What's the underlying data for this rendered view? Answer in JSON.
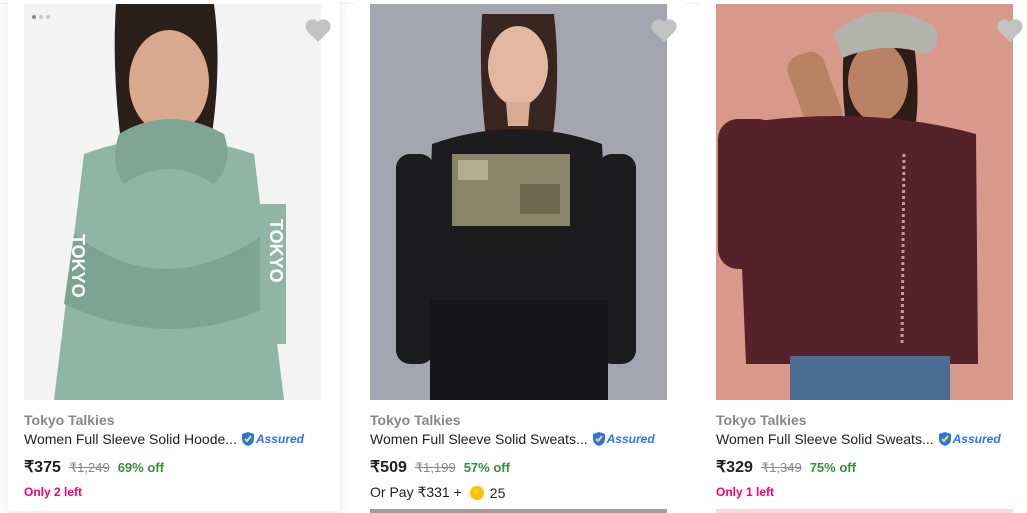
{
  "colors": {
    "accent": "#2874f0",
    "discount_green": "#388e3c",
    "stock_pink": "#ff0066",
    "brand_grey": "#878787"
  },
  "products": [
    {
      "brand": "Tokyo Talkies",
      "title": "Women Full Sleeve Solid Hoode...",
      "assured": "Assured",
      "price": "₹375",
      "mrp": "₹1,249",
      "discount": "69% off",
      "stock": "Only 2 left",
      "image_icon": "hoodie-model-image",
      "carousel_dots": 3
    },
    {
      "brand": "Tokyo Talkies",
      "title": "Women Full Sleeve Solid Sweats...",
      "assured": "Assured",
      "price": "₹509",
      "mrp": "₹1,199",
      "discount": "57% off",
      "offer_prefix": "Or Pay ₹331 +",
      "offer_coins": "25",
      "image_icon": "black-sweatshirt-model-image"
    },
    {
      "brand": "Tokyo Talkies",
      "title": "Women Full Sleeve Solid Sweats...",
      "assured": "Assured",
      "price": "₹329",
      "mrp": "₹1,349",
      "discount": "75% off",
      "stock": "Only 1 left",
      "image_icon": "maroon-sweatshirt-model-image"
    }
  ]
}
